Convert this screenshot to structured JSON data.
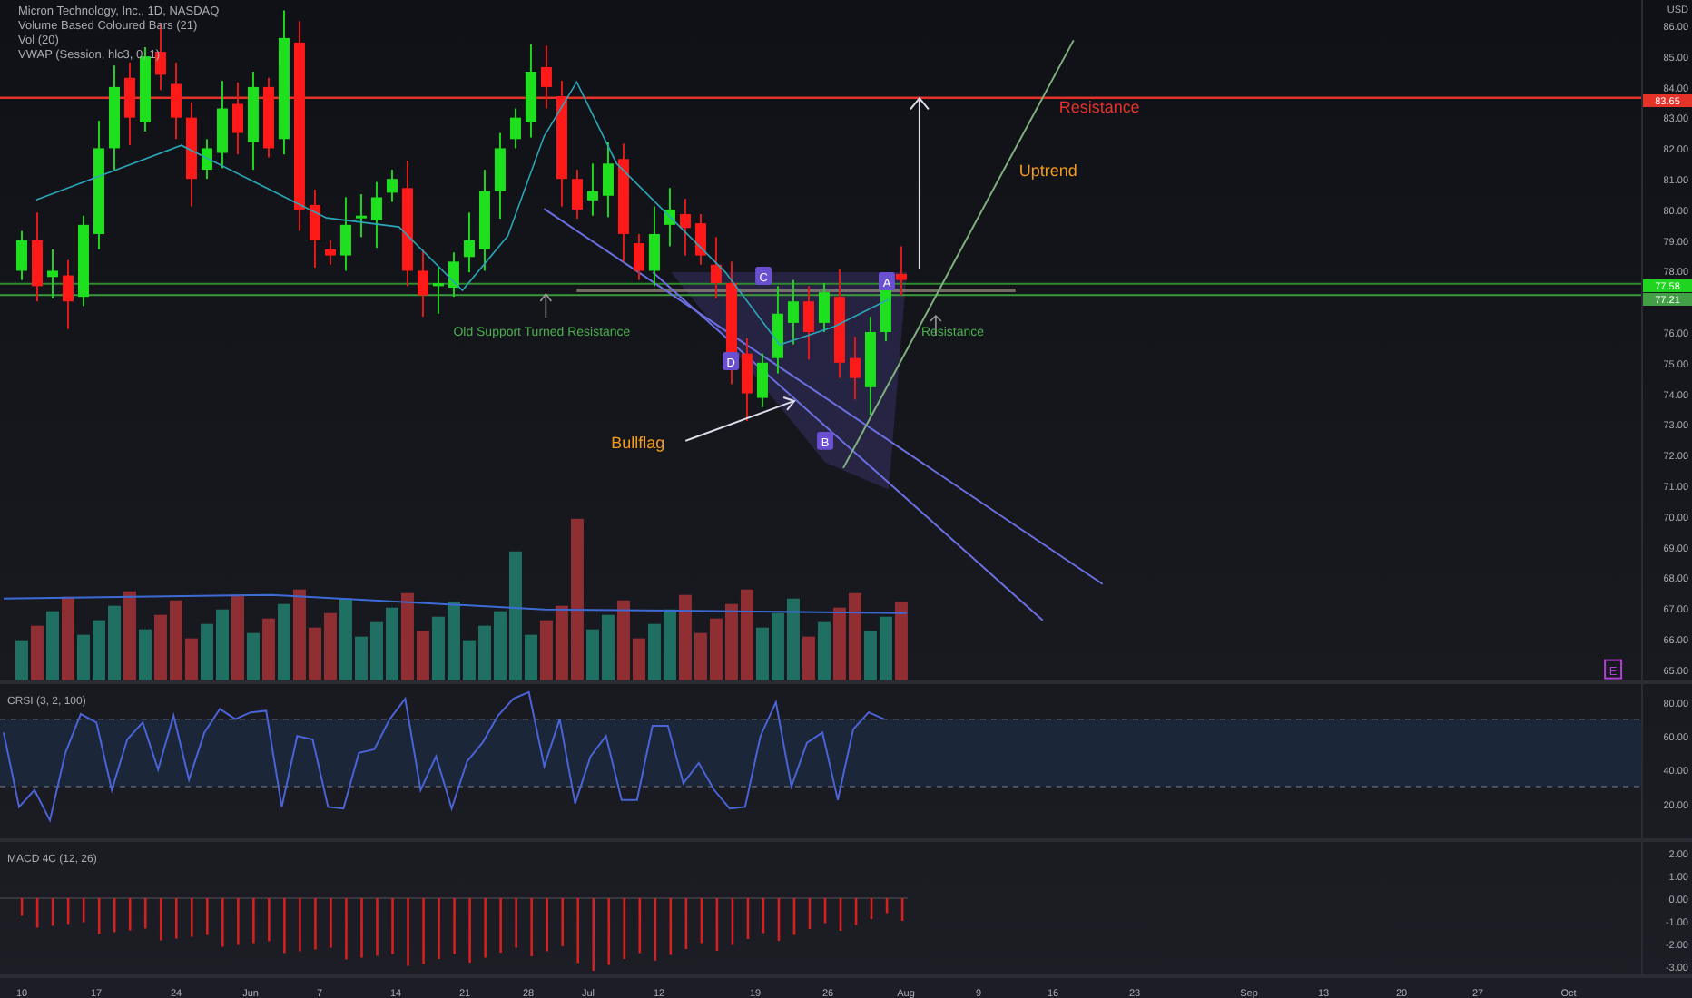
{
  "legend": {
    "symbol": "Micron Technology, Inc., 1D, NASDAQ",
    "indicators": [
      "Volume Based Coloured Bars (21)",
      "Vol (20)",
      "VWAP (Session, hlc3, 0, 1)"
    ]
  },
  "price_axis": {
    "currency": "USD",
    "ticks": [
      "86.00",
      "85.00",
      "84.00",
      "83.00",
      "82.00",
      "81.00",
      "80.00",
      "79.00",
      "78.00",
      "76.00",
      "75.00",
      "74.00",
      "73.00",
      "72.00",
      "71.00",
      "70.00",
      "69.00",
      "68.00",
      "67.00",
      "66.00",
      "65.00"
    ],
    "price_labels": [
      {
        "text": "83.65",
        "color": "#e5332a"
      },
      {
        "text": "77.58",
        "color": "#1fd51f"
      },
      {
        "text": "77.21",
        "color": "#43a047"
      }
    ]
  },
  "annotations": {
    "resistance_top": "Resistance",
    "uptrend": "Uptrend",
    "old_support": "Old Support Turned Resistance",
    "resistance_right": "Resistance",
    "bullflag": "Bullflag"
  },
  "pattern_points": [
    "C",
    "A",
    "D",
    "B"
  ],
  "earnings_badge": "E",
  "crsi": {
    "title": "CRSI (3, 2, 100)",
    "ticks": [
      "80.00",
      "60.00",
      "40.00",
      "20.00"
    ]
  },
  "macd": {
    "title": "MACD 4C (12, 26)",
    "ticks": [
      "2.00",
      "1.00",
      "0.00",
      "-1.00",
      "-2.00",
      "-3.00"
    ]
  },
  "date_axis": [
    "10",
    "17",
    "24",
    "Jun",
    "7",
    "14",
    "21",
    "28",
    "Jul",
    "12",
    "19",
    "26",
    "Aug",
    "9",
    "16",
    "23",
    "Sep",
    "13",
    "20",
    "27",
    "Oct"
  ]
}
